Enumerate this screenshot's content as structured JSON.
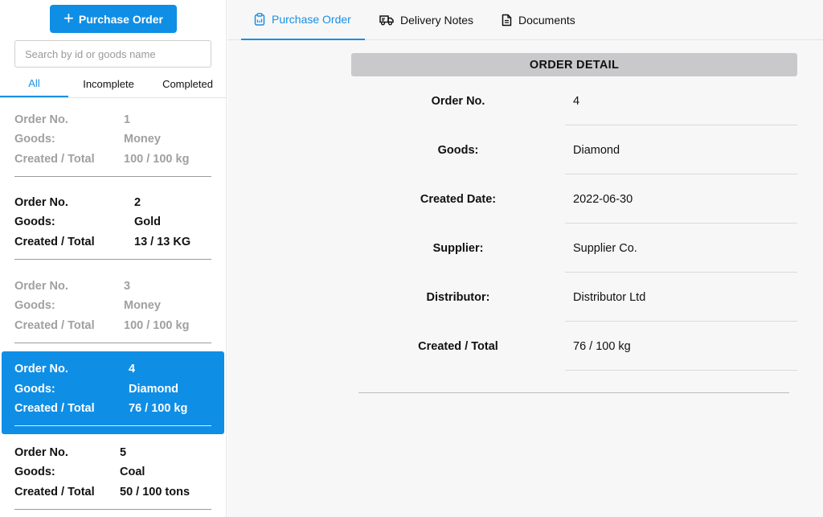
{
  "sidebar": {
    "new_button_label": "Purchase Order",
    "search_placeholder": "Search by id or goods name",
    "filters": [
      "All",
      "Incomplete",
      "Completed"
    ],
    "active_filter": "All",
    "orders": [
      {
        "k1": "Order No.",
        "v1": "1",
        "k2": "Goods:",
        "v2": "Money",
        "k3": "Created / Total",
        "v3": "100 / 100 kg",
        "state": "completed"
      },
      {
        "k1": "Order No.",
        "v1": "2",
        "k2": "Goods:",
        "v2": "Gold",
        "k3": "Created / Total",
        "v3": "13 / 13 KG",
        "state": "incomplete"
      },
      {
        "k1": "Order No.",
        "v1": "3",
        "k2": "Goods:",
        "v2": "Money",
        "k3": "Created / Total",
        "v3": "100 / 100 kg",
        "state": "completed"
      },
      {
        "k1": "Order No.",
        "v1": "4",
        "k2": "Goods:",
        "v2": "Diamond",
        "k3": "Created / Total",
        "v3": "76 / 100 kg",
        "state": "selected"
      },
      {
        "k1": "Order No.",
        "v1": "5",
        "k2": "Goods:",
        "v2": "Coal",
        "k3": "Created / Total",
        "v3": "50 / 100 tons",
        "state": "incomplete"
      }
    ]
  },
  "tabs": [
    {
      "label": "Purchase Order",
      "icon": "clipboard-icon",
      "active": true
    },
    {
      "label": "Delivery Notes",
      "icon": "truck-icon",
      "active": false
    },
    {
      "label": "Documents",
      "icon": "document-icon",
      "active": false
    }
  ],
  "detail": {
    "header": "ORDER DETAIL",
    "rows": [
      {
        "key": "Order No.",
        "value": "4"
      },
      {
        "key": "Goods:",
        "value": "Diamond"
      },
      {
        "key": "Created Date:",
        "value": "2022-06-30"
      },
      {
        "key": "Supplier:",
        "value": "Supplier Co."
      },
      {
        "key": "Distributor:",
        "value": "Distributor Ltd"
      },
      {
        "key": "Created / Total",
        "value": "76 / 100 kg"
      }
    ]
  },
  "colors": {
    "accent": "#0f8ee6",
    "tab_active": "#1a8fe3",
    "muted_text": "#a0a0a0",
    "header_bg": "#c9c9cc"
  }
}
